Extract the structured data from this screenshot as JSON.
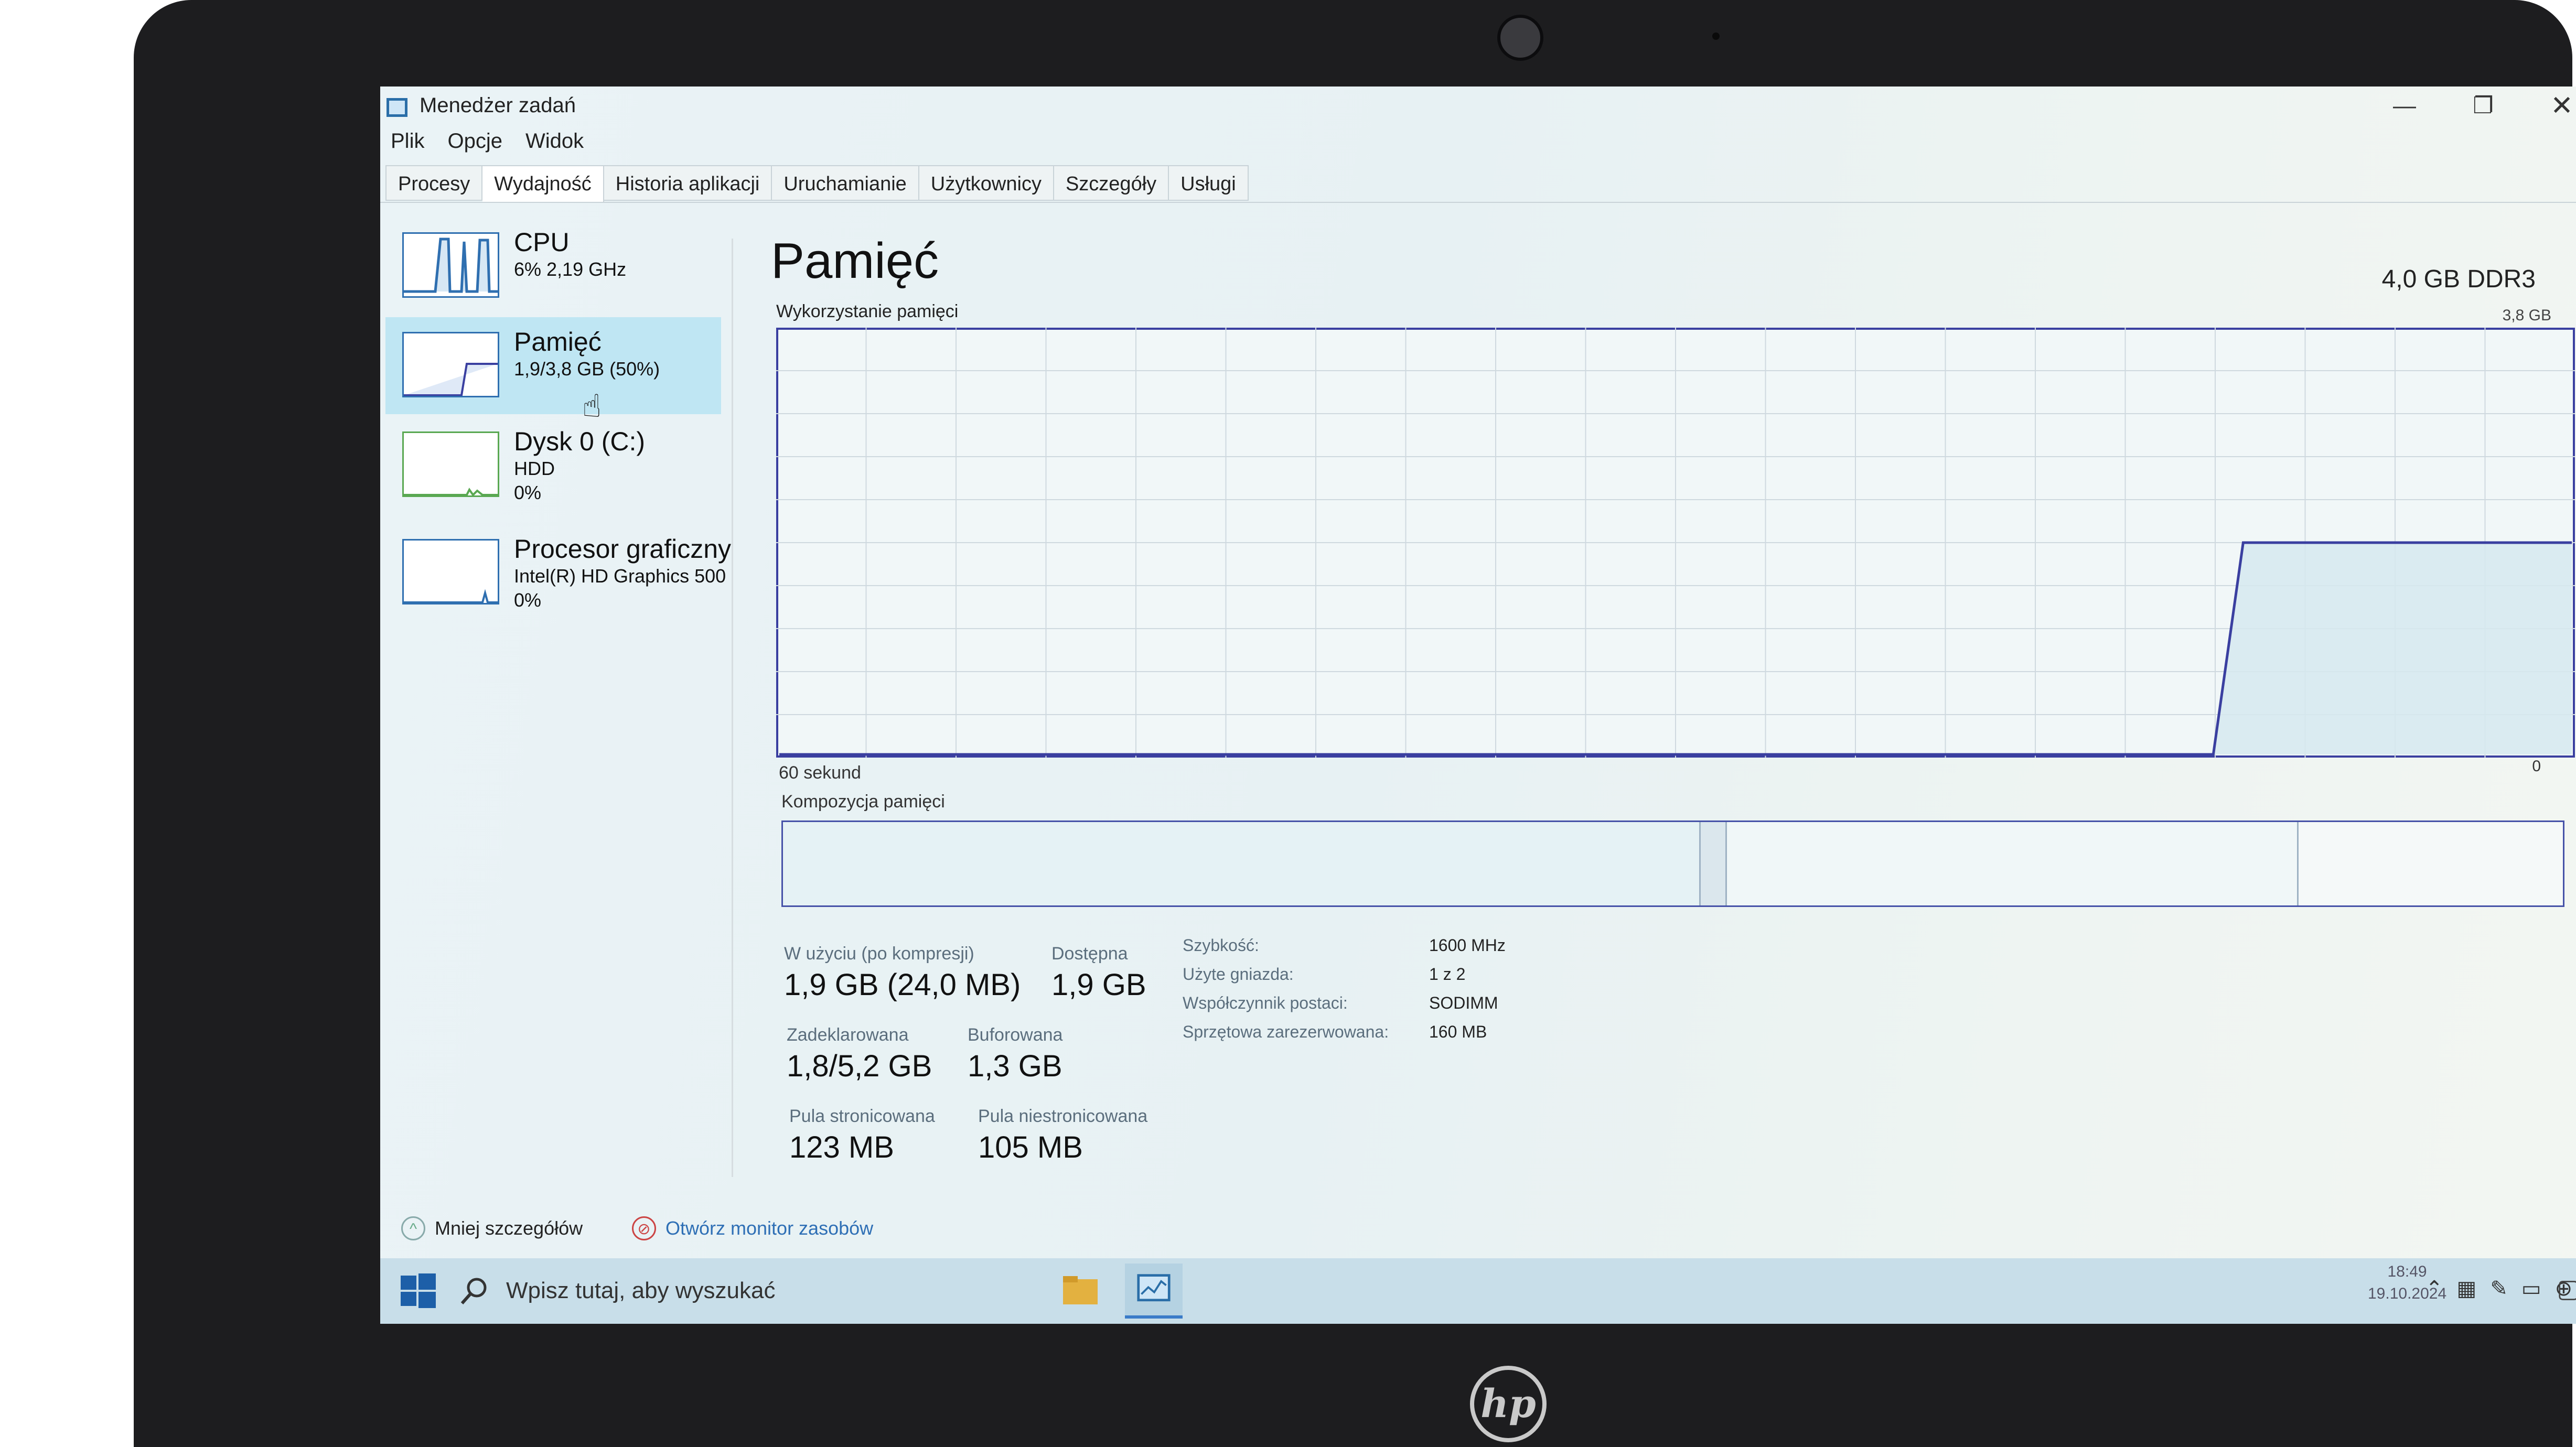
{
  "window": {
    "title": "Menedżer zadań"
  },
  "menu": [
    "Plik",
    "Opcje",
    "Widok"
  ],
  "tabs": [
    {
      "label": "Procesy",
      "active": false
    },
    {
      "label": "Wydajność",
      "active": true
    },
    {
      "label": "Historia aplikacji",
      "active": false
    },
    {
      "label": "Uruchamianie",
      "active": false
    },
    {
      "label": "Użytkownicy",
      "active": false
    },
    {
      "label": "Szczegóły",
      "active": false
    },
    {
      "label": "Usługi",
      "active": false
    }
  ],
  "sidebar": {
    "cpu": {
      "title": "CPU",
      "sub": "6% 2,19 GHz"
    },
    "memory": {
      "title": "Pamięć",
      "sub": "1,9/3,8 GB (50%)"
    },
    "disk": {
      "title": "Dysk 0 (C:)",
      "sub": "HDD",
      "sub2": "0%"
    },
    "gpu": {
      "title": "Procesor graficzny",
      "sub": "Intel(R) HD Graphics 500",
      "sub2": "0%"
    }
  },
  "main": {
    "title": "Pamięć",
    "mem_type": "4,0 GB DDR3",
    "usage_label": "Wykorzystanie pamięci",
    "usage_max": "3,8 GB",
    "axis_left": "60 sekund",
    "axis_right": "0",
    "composition_label": "Kompozycja pamięci"
  },
  "stats": {
    "in_use_label": "W użyciu (po kompresji)",
    "in_use_value": "1,9 GB (24,0 MB)",
    "available_label": "Dostępna",
    "available_value": "1,9 GB",
    "committed_label": "Zadeklarowana",
    "committed_value": "1,8/5,2 GB",
    "cached_label": "Buforowana",
    "cached_value": "1,3 GB",
    "paged_label": "Pula stronicowana",
    "paged_value": "123 MB",
    "nonpaged_label": "Pula niestronicowana",
    "nonpaged_value": "105 MB"
  },
  "details": [
    {
      "label": "Szybkość:",
      "value": "1600 MHz"
    },
    {
      "label": "Użyte gniazda:",
      "value": "1 z 2"
    },
    {
      "label": "Współczynnik postaci:",
      "value": "SODIMM"
    },
    {
      "label": "Sprzętowa zarezerwowana:",
      "value": "160 MB"
    }
  ],
  "footer": {
    "fewer_details": "Mniej szczegółów",
    "open_monitor": "Otwórz monitor zasobów"
  },
  "taskbar": {
    "search_placeholder": "Wpisz tutaj, aby wyszukać",
    "time": "18:49",
    "date": "19.10.2024"
  },
  "memory_graph": {
    "window_seconds": 60,
    "max_gb": 3.8,
    "usage_fraction": [
      0,
      0,
      0,
      0,
      0,
      0,
      0,
      0,
      0,
      0,
      0,
      0,
      0,
      0,
      0,
      0,
      0,
      0,
      0,
      0,
      0,
      0,
      0,
      0,
      0,
      0,
      0,
      0,
      0,
      0,
      0,
      0,
      0,
      0,
      0,
      0,
      0,
      0,
      0,
      0,
      0,
      0,
      0,
      0,
      0,
      0,
      0,
      0,
      0,
      0.5,
      0.5,
      0.5,
      0.5,
      0.5,
      0.5,
      0.5,
      0.5,
      0.5,
      0.5,
      0.5,
      0.5
    ]
  },
  "colors": {
    "accent": "#3a3fa0",
    "selected": "#bfe6f3",
    "link": "#2e6fb5"
  }
}
